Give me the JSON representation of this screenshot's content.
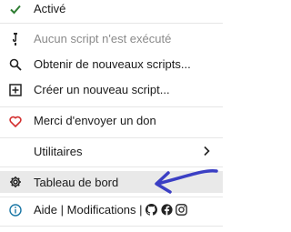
{
  "menu": {
    "active_label": "Activé",
    "no_script_label": "Aucun script n'est exécuté",
    "get_scripts_label": "Obtenir de nouveaux scripts...",
    "create_script_label": "Créer un nouveau script...",
    "donate_label": "Merci d'envoyer un don",
    "utilities_label": "Utilitaires",
    "dashboard_label": "Tableau de bord",
    "help_label": "Aide",
    "separator_text": "|",
    "changes_label": "Modifications"
  },
  "colors": {
    "check": "#2e7d32",
    "heart": "#d32f2f",
    "info": "#1976a5",
    "arrow_annotation": "#3b3fc4",
    "hover_bg": "#e9e9e9"
  },
  "icons": [
    "check-icon",
    "script-icon",
    "search-icon",
    "add-box-icon",
    "heart-icon",
    "chevron-right-icon",
    "gear-icon",
    "info-icon",
    "github-icon",
    "facebook-icon",
    "instagram-icon"
  ]
}
